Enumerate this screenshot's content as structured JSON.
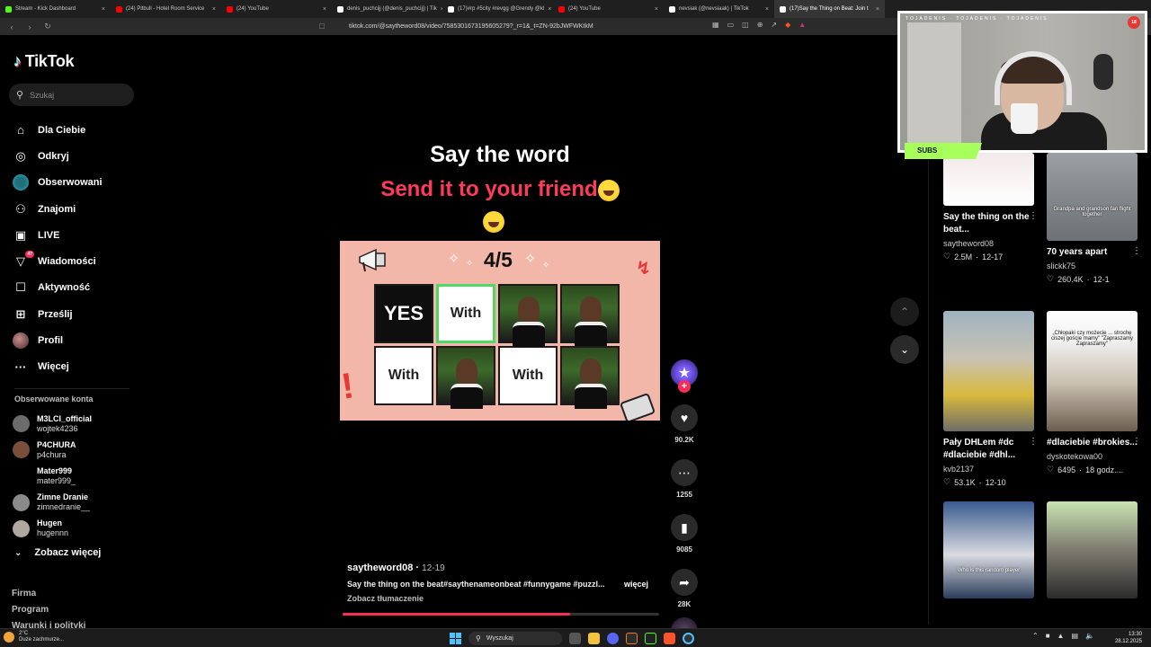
{
  "browser": {
    "tabs": [
      {
        "title": "Stream - Kick Dashboard",
        "color": "#53fc18"
      },
      {
        "title": "(24) Pitbull - Hotel Room Service",
        "color": "#ff0000"
      },
      {
        "title": "(24) YouTube",
        "color": "#ff0000"
      },
      {
        "title": "denis_puchcijj (@denis_puchcijj) | Tik",
        "color": "#ffffff"
      },
      {
        "title": "(17)#rp #5city #revgg @Grendy @kl",
        "color": "#ffffff"
      },
      {
        "title": "(24) YouTube",
        "color": "#ff0000"
      },
      {
        "title": "nevsiak (@nevsiaak) | TikTok",
        "color": "#ffffff"
      },
      {
        "title": "(17)Say the Thing on Beat: Join t",
        "color": "#ffffff",
        "active": true
      }
    ],
    "url": "tiktok.com/@saytheword08/video/7585301673195605279?_r=1&_t=ZN-92bJWFWKtkM"
  },
  "sidebar": {
    "logo": "TikTok",
    "search_placeholder": "Szukaj",
    "menu": [
      {
        "label": "Dla Ciebie",
        "icon": "home-icon"
      },
      {
        "label": "Odkryj",
        "icon": "compass-icon"
      },
      {
        "label": "Obserwowani",
        "icon": "following-icon"
      },
      {
        "label": "Znajomi",
        "icon": "friends-icon"
      },
      {
        "label": "LIVE",
        "icon": "live-icon"
      },
      {
        "label": "Wiadomości",
        "icon": "inbox-icon",
        "badge": "47"
      },
      {
        "label": "Aktywność",
        "icon": "activity-icon"
      },
      {
        "label": "Prześlij",
        "icon": "upload-icon"
      },
      {
        "label": "Profil",
        "icon": "profile-icon"
      },
      {
        "label": "Więcej",
        "icon": "more-icon"
      }
    ],
    "followed_title": "Obserwowane konta",
    "followed": [
      {
        "name": "M3LCI_official",
        "handle": "wojtek4236",
        "color": "#6c6c6c"
      },
      {
        "name": "P4CHURA",
        "handle": "p4chura",
        "color": "#7a4f3a"
      },
      {
        "name": "Mater999",
        "handle": "mater999_",
        "color": "#000000"
      },
      {
        "name": "Zimne Dranie",
        "handle": "zimnedranie__",
        "color": "#8a8a8a"
      },
      {
        "name": "Hugen",
        "handle": "hugennn",
        "color": "#b0a8a0"
      }
    ],
    "see_more": "Zobacz więcej",
    "footer": [
      "Firma",
      "Program",
      "Warunki i polityki"
    ]
  },
  "video": {
    "caption_line1": "Say the word",
    "caption_line2": "Send it to your friend",
    "game_score": "4/5",
    "grid": [
      {
        "type": "black",
        "text": "YES"
      },
      {
        "type": "white",
        "text": "With",
        "highlight": true
      },
      {
        "type": "photo",
        "text": ""
      },
      {
        "type": "photo",
        "text": ""
      },
      {
        "type": "white",
        "text": "With"
      },
      {
        "type": "photo",
        "text": ""
      },
      {
        "type": "white",
        "text": "With"
      },
      {
        "type": "photo",
        "text": ""
      }
    ],
    "author": "saytheword08",
    "date": "12-19",
    "description": "Say the thing on the beat#saythenameonbeat #funnygame #puzzl...",
    "more": "więcej",
    "translate": "Zobacz tłumaczenie",
    "progress": 0.72
  },
  "actions": {
    "likes": "90.2K",
    "comments": "1255",
    "saves": "9085",
    "shares": "28K"
  },
  "recommended": [
    {
      "title": "Say the thing on the beat...",
      "author": "saytheword08",
      "views": "2.5M",
      "date": "12-17"
    },
    {
      "title": "70 years apart",
      "author": "slickk75",
      "views": "260.4K",
      "date": "12-1",
      "overlay": "Grandpa and grandson fan flight together"
    },
    {
      "title": "Pały DHLem #dc #dlaciebie #dhl...",
      "author": "kvb2137",
      "views": "53.1K",
      "date": "12-10"
    },
    {
      "title": "#dlaciebie #brokies...",
      "author": "dyskotekowa00",
      "views": "6495",
      "date": "18 godz....",
      "overlay": "„Chłopaki czy możecie ... strochę ciszej goście mamy\" \"Zapraszamy Zapraszamy\""
    },
    {
      "title": "",
      "author": "",
      "views": "",
      "date": "",
      "overlay": "Who is this random player"
    },
    {
      "title": "",
      "author": "",
      "views": "",
      "date": "",
      "overlay": ""
    }
  ],
  "stream_overlay": {
    "label": "SUBS",
    "top_text": "TOJADENIS · TOJADENIS · TOJADENIS"
  },
  "taskbar": {
    "temp": "2°C",
    "weather": "Duże zachmurze...",
    "search": "Wyszukaj",
    "time": "13:30",
    "date": "28.12.2025"
  }
}
